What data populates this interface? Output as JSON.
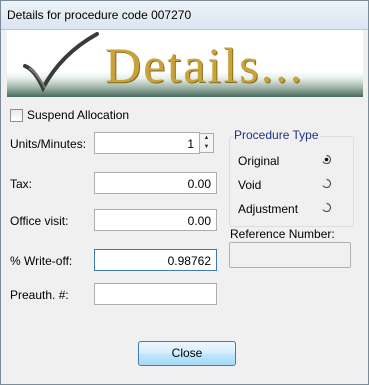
{
  "window": {
    "title": "Details for procedure code 007270"
  },
  "banner": {
    "heading": "Details..."
  },
  "form": {
    "suspend_allocation": {
      "label": "Suspend Allocation",
      "checked": false
    },
    "units_minutes": {
      "label": "Units/Minutes:",
      "value": "1"
    },
    "tax": {
      "label": "Tax:",
      "value": "0.00"
    },
    "office_visit": {
      "label": "Office visit:",
      "value": "0.00"
    },
    "write_off": {
      "label": "% Write-off:",
      "value": "0.98762"
    },
    "preauth": {
      "label": "Preauth. #:",
      "value": ""
    }
  },
  "procedure_type": {
    "title": "Procedure Type",
    "selected": "Original",
    "options": [
      {
        "label": "Original",
        "selected": true
      },
      {
        "label": "Void",
        "selected": false
      },
      {
        "label": "Adjustment",
        "selected": false
      }
    ]
  },
  "reference": {
    "label": "Reference Number:",
    "value": ""
  },
  "buttons": {
    "close_label": "Close"
  },
  "colors": {
    "accent": "#3c7fb1",
    "group_title": "#1e3287",
    "banner_text": "#caa23a",
    "banner_band": "#46695c"
  }
}
